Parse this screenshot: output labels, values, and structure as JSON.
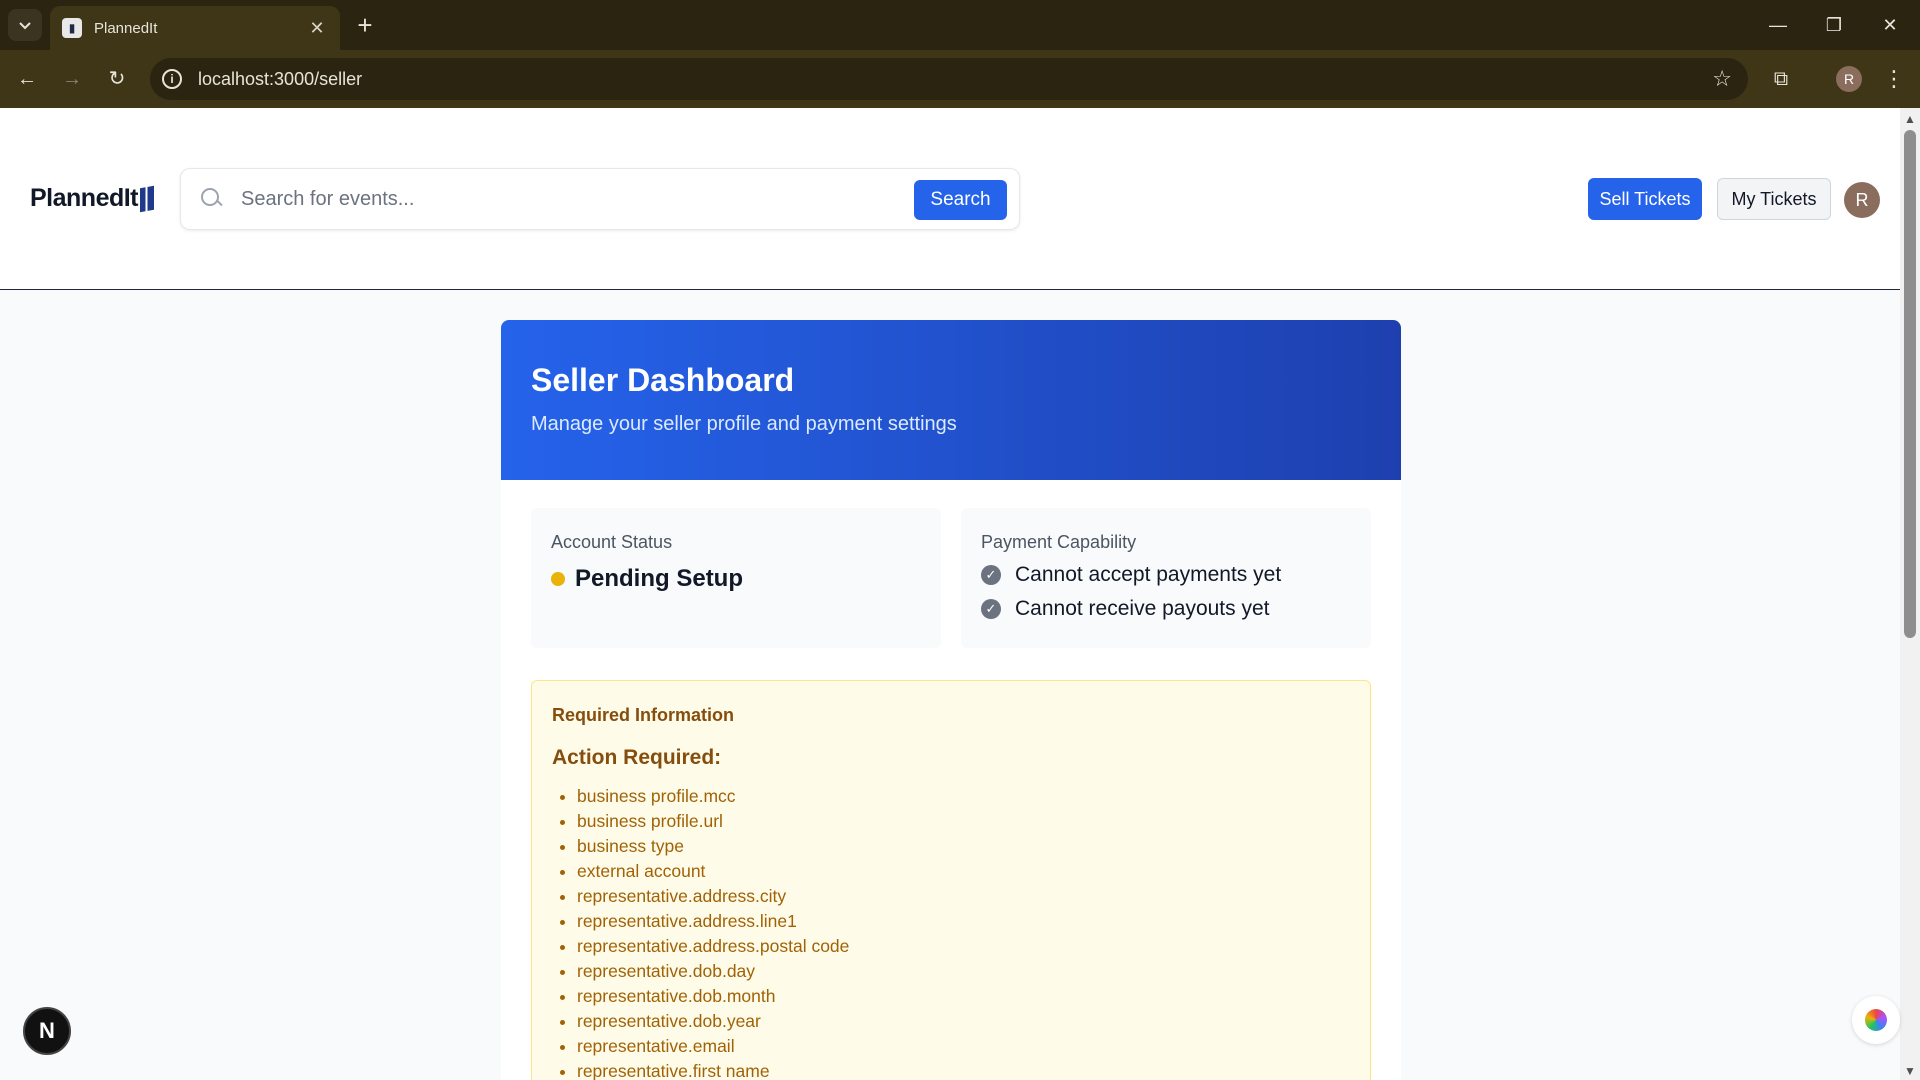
{
  "browser": {
    "tab_title": "PlannedIt",
    "tab_close": "✕",
    "new_tab": "+",
    "url": "localhost:3000/seller",
    "profile_initial": "R"
  },
  "header": {
    "logo": "PlannedIt",
    "search_placeholder": "Search for events...",
    "search_button": "Search",
    "sell_tickets": "Sell Tickets",
    "my_tickets": "My Tickets",
    "avatar_initial": "R"
  },
  "dashboard": {
    "title": "Seller Dashboard",
    "subtitle": "Manage your seller profile and payment settings",
    "account_status": {
      "label": "Account Status",
      "value": "Pending Setup",
      "status_color": "#eab308"
    },
    "payment_capability": {
      "label": "Payment Capability",
      "items": [
        "Cannot accept payments yet",
        "Cannot receive payouts yet"
      ]
    },
    "required_info": {
      "label": "Required Information",
      "action_title": "Action Required:",
      "items": [
        "business profile.mcc",
        "business profile.url",
        "business type",
        "external account",
        "representative.address.city",
        "representative.address.line1",
        "representative.address.postal code",
        "representative.dob.day",
        "representative.dob.month",
        "representative.dob.year",
        "representative.email",
        "representative.first name"
      ]
    }
  },
  "widgets": {
    "next_badge": "N"
  },
  "colors": {
    "accent": "#2563eb",
    "hero_gradient_end": "#1e40af",
    "warning_bg": "#fefce8"
  }
}
